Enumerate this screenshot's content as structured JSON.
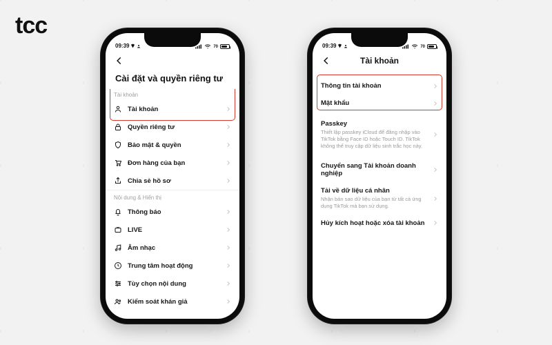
{
  "brand": {
    "logo": "tcc"
  },
  "status": {
    "time": "09:39",
    "battery": "70"
  },
  "left": {
    "title": "Cài đặt và quyền riêng tư",
    "sections": [
      {
        "label": "Tài khoản",
        "items": [
          {
            "icon": "person",
            "label": "Tài khoản"
          },
          {
            "icon": "lock",
            "label": "Quyền riêng tư"
          },
          {
            "icon": "shield",
            "label": "Bảo mật & quyền"
          },
          {
            "icon": "cart",
            "label": "Đơn hàng của bạn"
          },
          {
            "icon": "share",
            "label": "Chia sẻ hồ sơ"
          }
        ]
      },
      {
        "label": "Nội dung & Hiển thị",
        "items": [
          {
            "icon": "bell",
            "label": "Thông báo"
          },
          {
            "icon": "live",
            "label": "LIVE"
          },
          {
            "icon": "music",
            "label": "Âm nhạc"
          },
          {
            "icon": "activity",
            "label": "Trung tâm hoạt động"
          },
          {
            "icon": "sliders",
            "label": "Tùy chọn nội dung"
          },
          {
            "icon": "audience",
            "label": "Kiểm soát khán giả"
          }
        ]
      }
    ]
  },
  "right": {
    "title": "Tài khoản",
    "items": [
      {
        "label": "Thông tin tài khoản"
      },
      {
        "label": "Mật khẩu"
      },
      {
        "label": "Passkey",
        "desc": "Thiết lập passkey iCloud để đăng nhập vào TikTok bằng Face ID hoặc Touch ID. TikTok không thể truy cập dữ liệu sinh trắc học này."
      },
      {
        "label": "Chuyển sang Tài khoản doanh nghiệp"
      },
      {
        "label": "Tải về dữ liệu cá nhân",
        "desc": "Nhận bản sao dữ liệu của bạn từ tất cả ứng dụng TikTok mà bạn sử dụng."
      },
      {
        "label": "Hủy kích hoạt hoặc xóa tài khoản"
      }
    ]
  }
}
